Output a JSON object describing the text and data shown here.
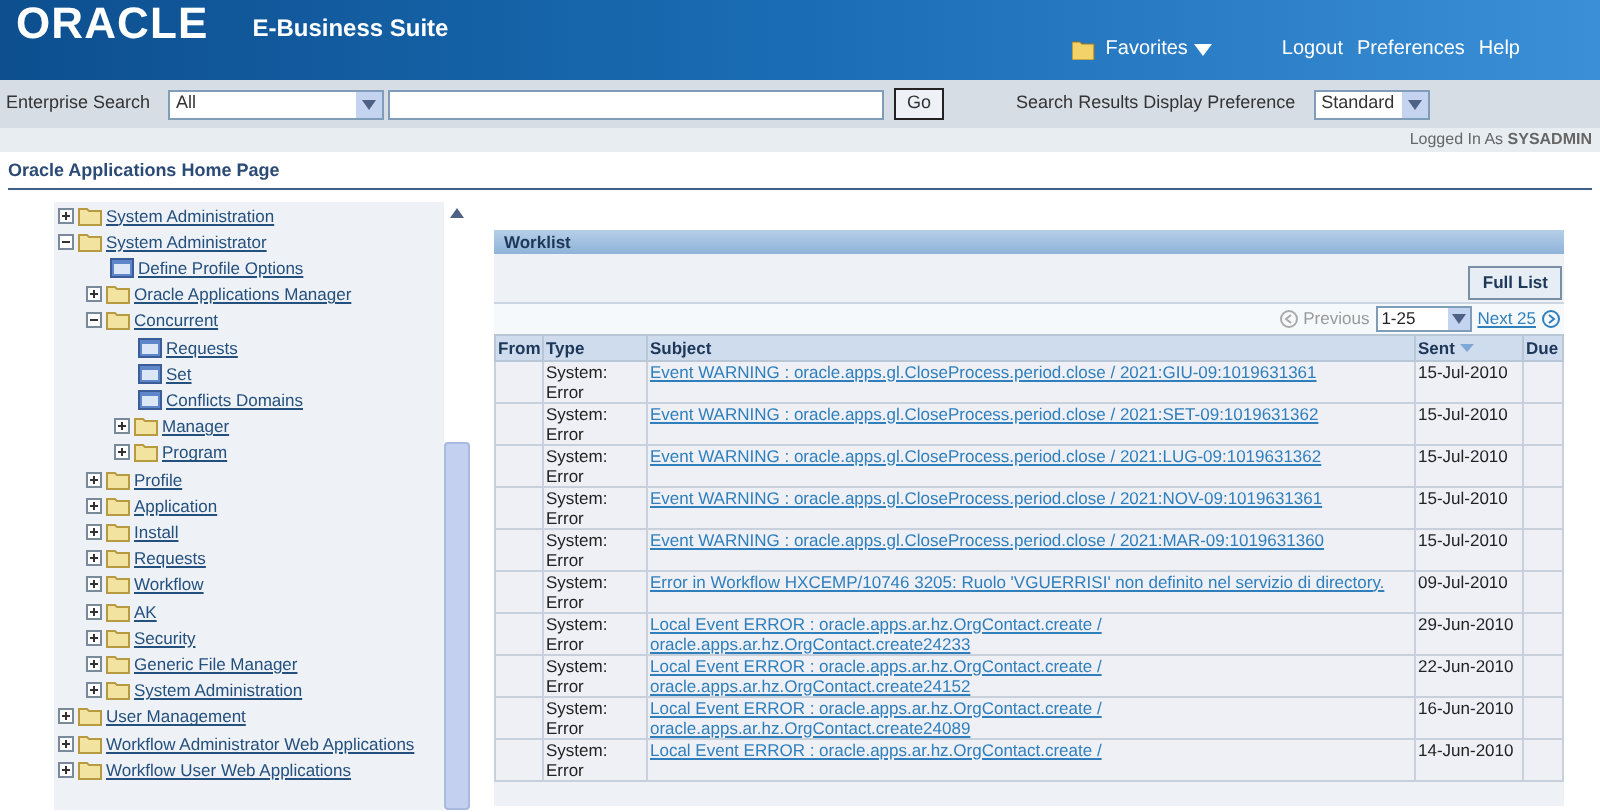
{
  "header": {
    "logo": "ORACLE",
    "product": "E-Business Suite",
    "favorites": "Favorites",
    "links": [
      "Logout",
      "Preferences",
      "Help"
    ]
  },
  "search_bar": {
    "label": "Enterprise Search",
    "scope": "All",
    "go": "Go",
    "preference_label": "Search Results Display Preference",
    "preference": "Standard"
  },
  "logged_in": "Logged In As **SYSADMIN**",
  "page_title": "Oracle Applications Home Page",
  "navigator": [
    {
      "kind": "folder",
      "label": "System Administration",
      "expanded": false
    },
    {
      "kind": "folder",
      "label": "System Administrator",
      "expanded": true,
      "children": [
        {
          "kind": "function",
          "label": "Define Profile Options"
        },
        {
          "kind": "folder",
          "label": "Oracle Applications Manager",
          "expanded": false
        },
        {
          "kind": "folder",
          "label": "Concurrent",
          "expanded": true,
          "children": [
            {
              "kind": "function",
              "label": "Requests"
            },
            {
              "kind": "function",
              "label": "Set"
            },
            {
              "kind": "function",
              "label": "Conflicts Domains"
            },
            {
              "kind": "folder",
              "label": "Manager",
              "expanded": false
            },
            {
              "kind": "folder",
              "label": "Program",
              "expanded": false
            }
          ]
        },
        {
          "kind": "folder",
          "label": "Profile",
          "expanded": false
        },
        {
          "kind": "folder",
          "label": "Application",
          "expanded": false
        },
        {
          "kind": "folder",
          "label": "Install",
          "expanded": false
        },
        {
          "kind": "folder",
          "label": "Requests",
          "expanded": false
        },
        {
          "kind": "folder",
          "label": "Workflow",
          "expanded": false
        },
        {
          "kind": "folder",
          "label": "AK",
          "expanded": false
        },
        {
          "kind": "folder",
          "label": "Security",
          "expanded": false
        },
        {
          "kind": "folder",
          "label": "Generic File Manager",
          "expanded": false
        },
        {
          "kind": "folder",
          "label": "System Administration",
          "expanded": false
        }
      ]
    },
    {
      "kind": "folder",
      "label": "User Management",
      "expanded": false
    },
    {
      "kind": "folder",
      "label": "Workflow Administrator Web Applications",
      "expanded": false
    },
    {
      "kind": "folder",
      "label": "Workflow User Web Applications",
      "expanded": false
    }
  ],
  "worklist": {
    "title": "Worklist",
    "full_list": "Full List",
    "previous": {
      "label": "Previous",
      "disabled": true
    },
    "range": "1-25",
    "next": {
      "label": "Next 25",
      "disabled": false
    },
    "columns": [
      "From",
      "Type",
      "Subject",
      "Sent",
      "Due"
    ],
    "rows": [
      {
        "from": "",
        "type": "System: Error",
        "subject": "Event WARNING : oracle.apps.gl.CloseProcess.period.close / 2021:GIU-09:1019631361",
        "sent": "15-Jul-2010"
      },
      {
        "from": "",
        "type": "System: Error",
        "subject": "Event WARNING : oracle.apps.gl.CloseProcess.period.close / 2021:SET-09:1019631362",
        "sent": "15-Jul-2010"
      },
      {
        "from": "",
        "type": "System: Error",
        "subject": "Event WARNING : oracle.apps.gl.CloseProcess.period.close / 2021:LUG-09:1019631362",
        "sent": "15-Jul-2010"
      },
      {
        "from": "",
        "type": "System: Error",
        "subject": "Event WARNING : oracle.apps.gl.CloseProcess.period.close / 2021:NOV-09:1019631361",
        "sent": "15-Jul-2010"
      },
      {
        "from": "",
        "type": "System: Error",
        "subject": "Event WARNING : oracle.apps.gl.CloseProcess.period.close / 2021:MAR-09:1019631360",
        "sent": "15-Jul-2010"
      },
      {
        "from": "",
        "type": "System: Error",
        "subject": "Error in Workflow HXCEMP/10746 3205: Ruolo 'VGUERRISI' non definito nel servizio di directory.",
        "sent": "09-Jul-2010"
      },
      {
        "from": "",
        "type": "System: Error",
        "subject": "Local Event ERROR : oracle.apps.ar.hz.OrgContact.create / oracle.apps.ar.hz.OrgContact.create24233",
        "sent": "29-Jun-2010"
      },
      {
        "from": "",
        "type": "System: Error",
        "subject": "Local Event ERROR : oracle.apps.ar.hz.OrgContact.create / oracle.apps.ar.hz.OrgContact.create24152",
        "sent": "22-Jun-2010"
      },
      {
        "from": "",
        "type": "System: Error",
        "subject": "Local Event ERROR : oracle.apps.ar.hz.OrgContact.create / oracle.apps.ar.hz.OrgContact.create24089",
        "sent": "16-Jun-2010"
      },
      {
        "from": "",
        "type": "System: Error",
        "subject": "Local Event ERROR : oracle.apps.ar.hz.OrgContact.create /",
        "sent": "14-Jun-2010"
      }
    ]
  }
}
